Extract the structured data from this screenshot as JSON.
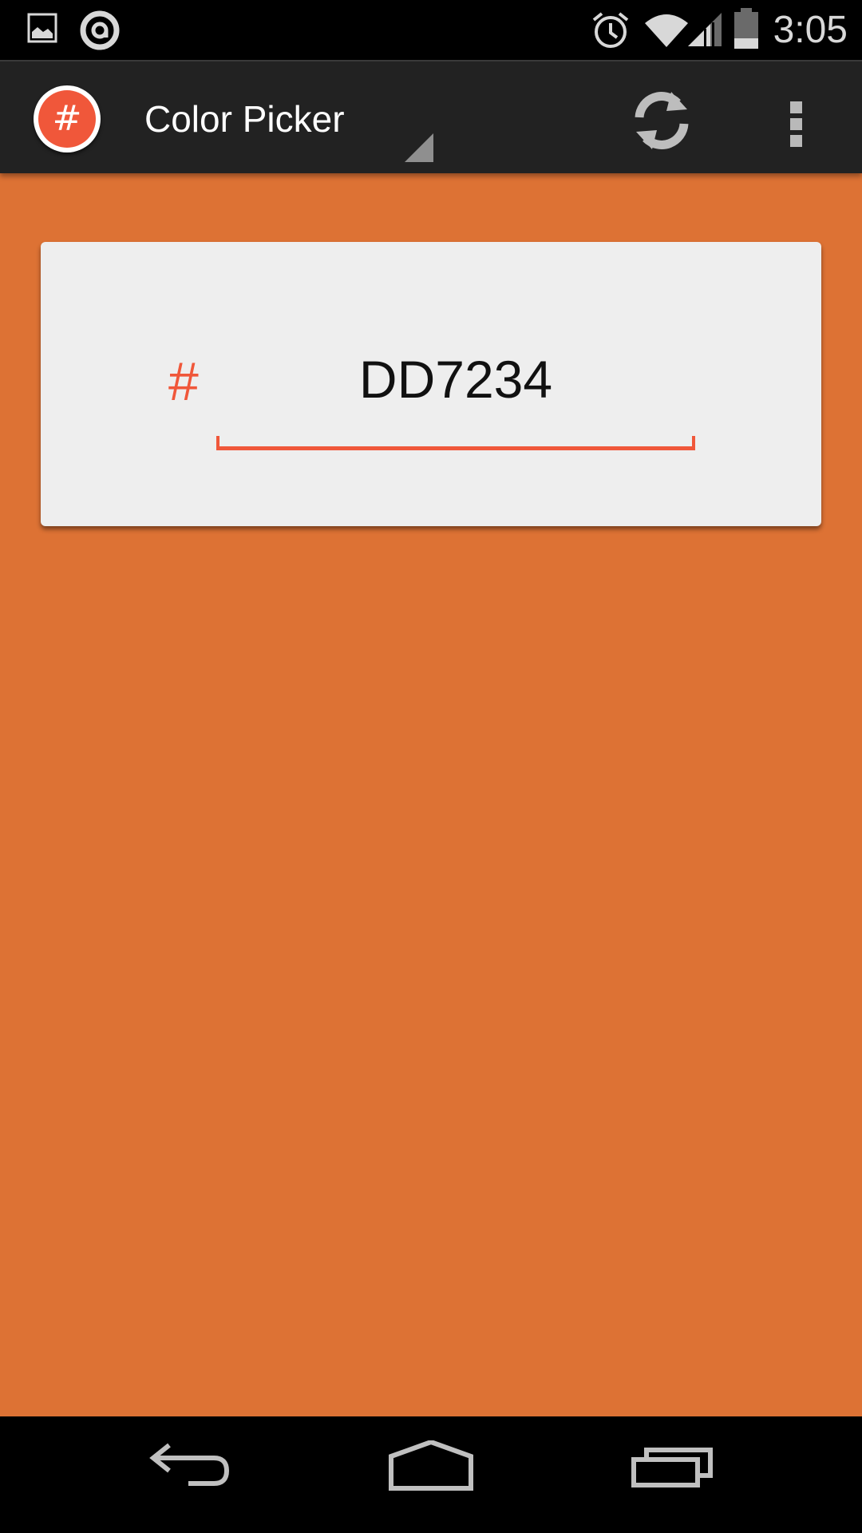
{
  "status_bar": {
    "time": "3:05",
    "icons": [
      "gallery-icon",
      "app-notification-icon",
      "alarm-icon",
      "wifi-icon",
      "signal-icon",
      "battery-icon"
    ]
  },
  "action_bar": {
    "app_logo_glyph": "#",
    "title": "Color Picker",
    "actions": [
      "refresh-icon",
      "overflow-menu-icon"
    ]
  },
  "color_input": {
    "prefix": "#",
    "value": "DD7234"
  },
  "colors": {
    "background": "#DD7234",
    "accent": "#F0573A",
    "card": "#EEEEEE",
    "action_bar": "#222222"
  },
  "nav_bar": {
    "buttons": [
      "back-icon",
      "home-icon",
      "recents-icon"
    ]
  }
}
